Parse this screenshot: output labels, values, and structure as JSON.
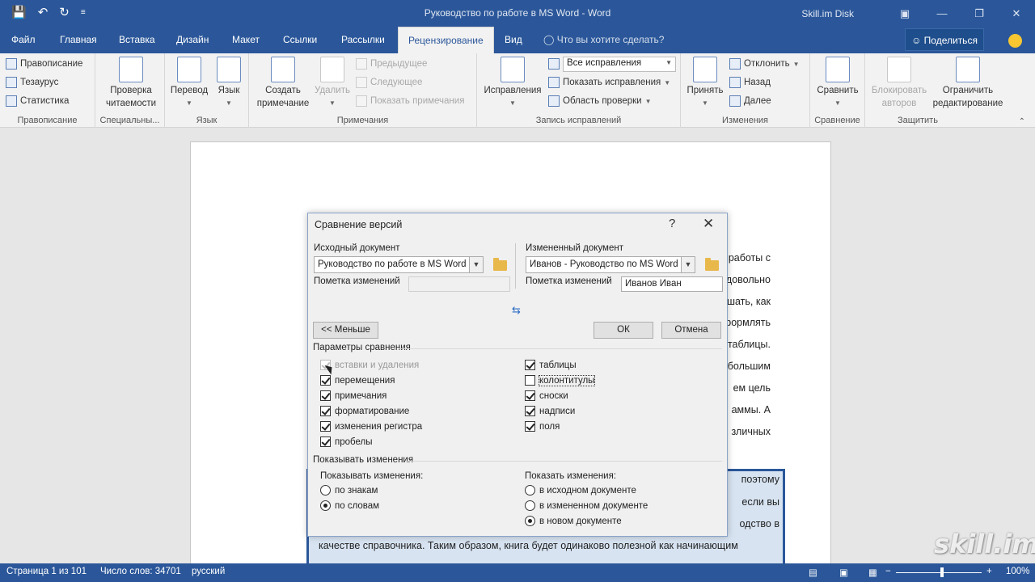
{
  "titlebar": {
    "title": "Руководство по работе в MS Word  -  Word",
    "disk": "Skill.im Disk"
  },
  "tabs": {
    "file": "Файл",
    "items": [
      "Главная",
      "Вставка",
      "Дизайн",
      "Макет",
      "Ссылки",
      "Рассылки",
      "Рецензирование",
      "Вид"
    ],
    "active": "Рецензирование",
    "tell_me": "Что вы хотите сделать?",
    "share": "Поделиться"
  },
  "ribbon": {
    "proofing": {
      "label": "Правописание",
      "spelling": "Правописание",
      "thesaurus": "Тезаурус",
      "stats": "Статистика"
    },
    "special": {
      "label": "Специальны...",
      "check_line1": "Проверка",
      "check_line2": "читаемости"
    },
    "language": {
      "label": "Язык",
      "translate": "Перевод",
      "lang": "Язык"
    },
    "comments": {
      "label": "Примечания",
      "new_line1": "Создать",
      "new_line2": "примечание",
      "delete": "Удалить",
      "prev": "Предыдущее",
      "next": "Следующее",
      "show": "Показать примечания"
    },
    "tracking": {
      "label": "Запись исправлений",
      "track": "Исправления",
      "combo": "Все исправления",
      "show_markup": "Показать исправления",
      "pane": "Область проверки"
    },
    "changes": {
      "label": "Изменения",
      "accept": "Принять",
      "reject": "Отклонить",
      "back": "Назад",
      "next": "Далее"
    },
    "compare": {
      "label": "Сравнение",
      "compare": "Сравнить"
    },
    "protect": {
      "label": "Защитить",
      "block_line1": "Блокировать",
      "block_line2": "авторов",
      "restrict_line1": "Ограничить",
      "restrict_line2": "редактирование"
    }
  },
  "document": {
    "right_fragments": [
      "работы с",
      "довольно",
      "шать, как",
      "формлять",
      "таблицы.",
      "большим",
      "ем цель",
      "аммы. А",
      "зличных"
    ],
    "blue_lines": [
      "поэтому",
      "если вы",
      "одство в",
      "качестве справочника. Таким образом, книга будет одинаково полезной как начинающим"
    ]
  },
  "dialog": {
    "title": "Сравнение версий",
    "help": "?",
    "original_label": "Исходный документ",
    "original_value": "Руководство по работе в MS Word",
    "original_mark_label": "Пометка изменений",
    "original_mark_value": "",
    "revised_label": "Измененный документ",
    "revised_value": "Иванов - Руководство по MS Word",
    "revised_mark_label": "Пометка изменений",
    "revised_mark_value": "Иванов Иван",
    "less_button": "<< Меньше",
    "ok_button": "ОК",
    "cancel_button": "Отмена",
    "settings_label": "Параметры сравнения",
    "left_checks": [
      {
        "label": "вставки и удаления",
        "checked": true,
        "disabled": true
      },
      {
        "label": "перемещения",
        "checked": true,
        "disabled": false
      },
      {
        "label": "примечания",
        "checked": true,
        "disabled": false
      },
      {
        "label": "форматирование",
        "checked": true,
        "disabled": false
      },
      {
        "label": "изменения регистра",
        "checked": true,
        "disabled": false
      },
      {
        "label": "пробелы",
        "checked": true,
        "disabled": false
      }
    ],
    "right_checks": [
      {
        "label": "таблицы",
        "checked": true
      },
      {
        "label": "колонтитулы",
        "checked": false
      },
      {
        "label": "сноски",
        "checked": true
      },
      {
        "label": "надписи",
        "checked": true
      },
      {
        "label": "поля",
        "checked": true
      }
    ],
    "show_changes_label": "Показывать изменения",
    "level_label": "Показывать изменения:",
    "level_options": [
      {
        "label": "по знакам",
        "selected": false
      },
      {
        "label": "по словам",
        "selected": true
      }
    ],
    "location_label": "Показать изменения:",
    "location_options": [
      {
        "label": "в исходном документе",
        "selected": false
      },
      {
        "label": "в измененном документе",
        "selected": false
      },
      {
        "label": "в новом документе",
        "selected": true
      }
    ]
  },
  "statusbar": {
    "page": "Страница 1 из 101",
    "words": "Число слов: 34701",
    "lang": "русский",
    "zoom": "100%",
    "zoom_level": 1.0
  },
  "watermark": "skill.im"
}
